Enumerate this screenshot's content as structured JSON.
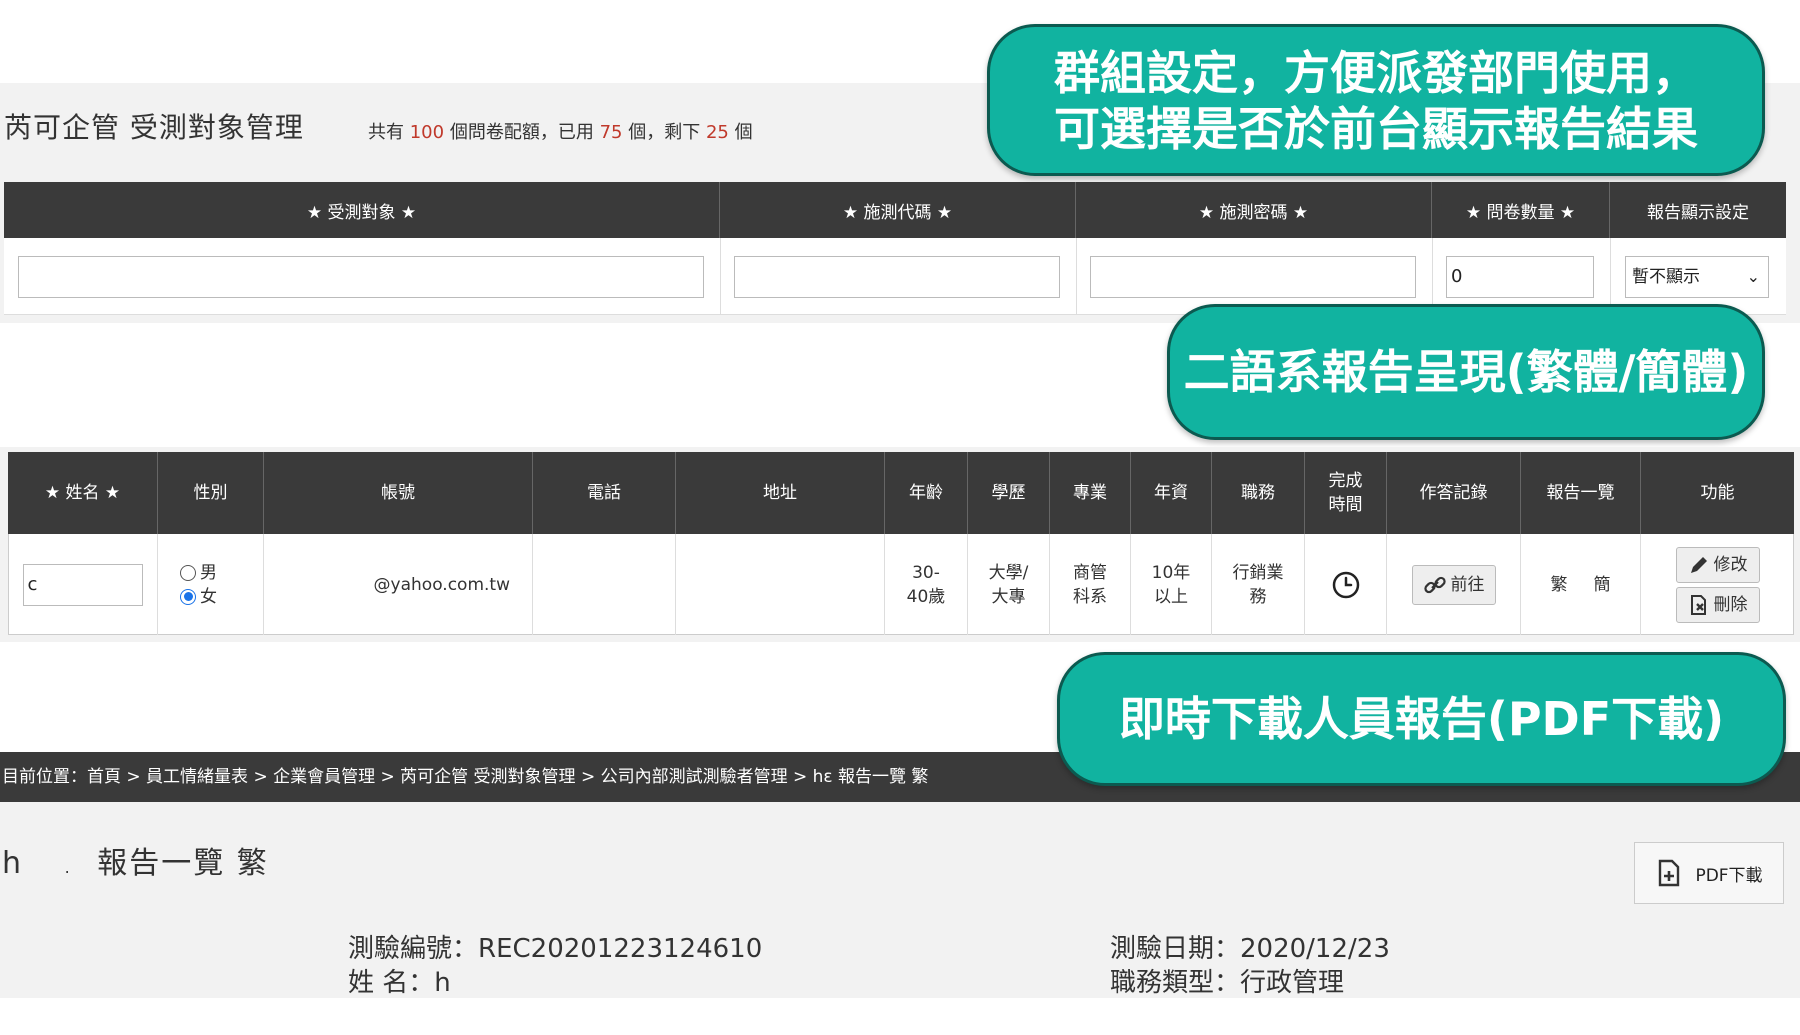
{
  "panel1": {
    "title": "芮可企管 受測對象管理",
    "quota": {
      "prefix": "共有",
      "total": "100",
      "mid1": "個問卷配額，已用",
      "used": "75",
      "mid2": "個，剩下",
      "remaining": "25",
      "suffix": "個"
    },
    "headers": [
      "★ 受測對象 ★",
      "★ 施測代碼 ★",
      "★ 施測密碼 ★",
      "★ 問卷數量 ★",
      "報告顯示設定"
    ],
    "fields": {
      "subject": "",
      "code": "",
      "password": "",
      "quantity": "0",
      "display_setting": "暫不顯示"
    }
  },
  "callouts": {
    "group": [
      "群組設定，方便派發部門使用，",
      "可選擇是否於前台顯示報告結果"
    ],
    "language": "二語系報告呈現(繁體/簡體)",
    "download": "即時下載人員報告(PDF下載)"
  },
  "panel2": {
    "headers": {
      "name": "★ 姓名 ★",
      "gender": "性別",
      "account": "帳號",
      "phone": "電話",
      "address": "地址",
      "age": "年齡",
      "education": "學歷",
      "major": "專業",
      "seniority": "年資",
      "position": "職務",
      "completion_l1": "完成",
      "completion_l2": "時間",
      "record": "作答記錄",
      "report": "報告一覽",
      "function": "功能"
    },
    "row": {
      "name": "c",
      "gender_male": "男",
      "gender_female": "女",
      "gender_selected": "女",
      "account": "@yahoo.com.tw",
      "phone": "",
      "address": "",
      "age_l1": "30-",
      "age_l2": "40歲",
      "edu_l1": "大學/",
      "edu_l2": "大專",
      "major_l1": "商管",
      "major_l2": "科系",
      "seniority_l1": "10年",
      "seniority_l2": "以上",
      "position_l1": "行銷業",
      "position_l2": "務",
      "record_btn": "前往",
      "report_trad": "繁",
      "report_simp": "簡",
      "edit_btn": "修改",
      "delete_btn": "刪除"
    }
  },
  "panel3": {
    "breadcrumb": "目前位置：首頁 > 員工情緒量表 > 企業會員管理 > 芮可企管 受測對象管理 > 公司內部測試測驗者管理 > hε     報告一覽 繁",
    "title_prefix": "h",
    "title_dot": ".",
    "title_main": "報告一覽 繁",
    "pdf_button": "PDF下載",
    "info": {
      "test_no": "測驗編號：REC20201223124610",
      "test_date": "測驗日期：2020/12/23",
      "name": "姓 名：h",
      "job_type": "職務類型：行政管理"
    }
  },
  "colors": {
    "callout_bg": "#11b3a0",
    "callout_border": "#0c5a50",
    "header_bg": "#3a3a3a",
    "accent_red": "#c0392b"
  }
}
